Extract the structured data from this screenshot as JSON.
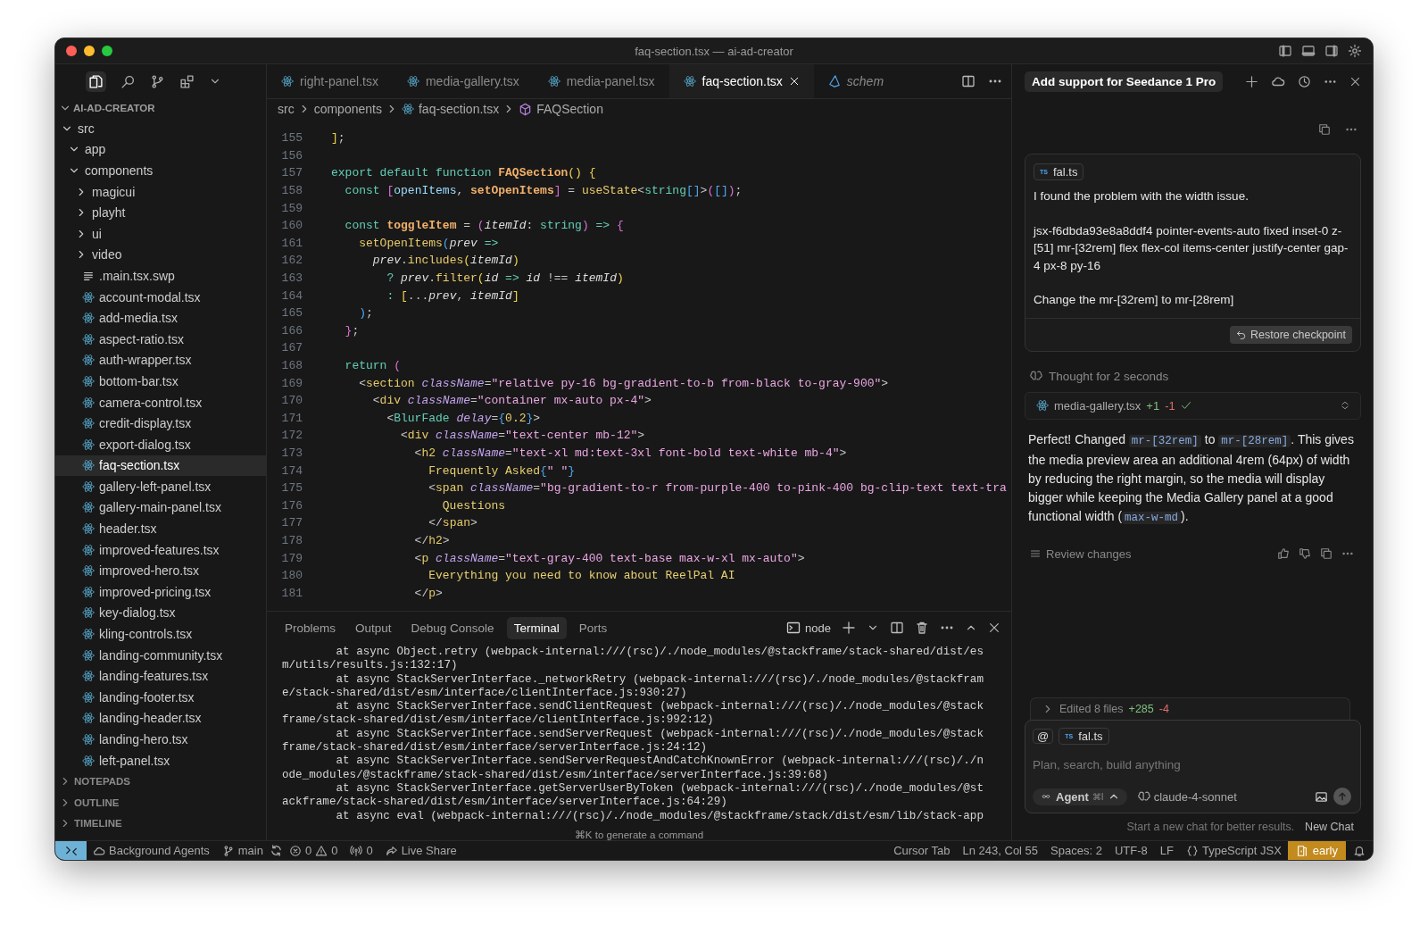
{
  "window": {
    "title": "faq-section.tsx — ai-ad-creator"
  },
  "explorer": {
    "title": "AI-AD-CREATOR",
    "tree": [
      {
        "name": "src",
        "kind": "folder",
        "expanded": true,
        "selected": false,
        "children": [
          {
            "name": "app",
            "kind": "folder",
            "expanded": true,
            "selected": false
          },
          {
            "name": "components",
            "kind": "folder",
            "expanded": true,
            "selected": false,
            "children": [
              {
                "name": "magicui",
                "kind": "folder",
                "expanded": false,
                "selected": false
              },
              {
                "name": "playht",
                "kind": "folder",
                "expanded": false,
                "selected": false
              },
              {
                "name": "ui",
                "kind": "folder",
                "expanded": false,
                "selected": false
              },
              {
                "name": "video",
                "kind": "folder",
                "expanded": false,
                "selected": false
              },
              {
                "name": ".main.tsx.swp",
                "kind": "text",
                "selected": false
              },
              {
                "name": "account-modal.tsx",
                "kind": "react",
                "selected": false
              },
              {
                "name": "add-media.tsx",
                "kind": "react",
                "selected": false
              },
              {
                "name": "aspect-ratio.tsx",
                "kind": "react",
                "selected": false
              },
              {
                "name": "auth-wrapper.tsx",
                "kind": "react",
                "selected": false
              },
              {
                "name": "bottom-bar.tsx",
                "kind": "react",
                "selected": false
              },
              {
                "name": "camera-control.tsx",
                "kind": "react",
                "selected": false
              },
              {
                "name": "credit-display.tsx",
                "kind": "react",
                "selected": false
              },
              {
                "name": "export-dialog.tsx",
                "kind": "react",
                "selected": false
              },
              {
                "name": "faq-section.tsx",
                "kind": "react",
                "selected": true
              },
              {
                "name": "gallery-left-panel.tsx",
                "kind": "react",
                "selected": false
              },
              {
                "name": "gallery-main-panel.tsx",
                "kind": "react",
                "selected": false
              },
              {
                "name": "header.tsx",
                "kind": "react",
                "selected": false
              },
              {
                "name": "improved-features.tsx",
                "kind": "react",
                "selected": false
              },
              {
                "name": "improved-hero.tsx",
                "kind": "react",
                "selected": false
              },
              {
                "name": "improved-pricing.tsx",
                "kind": "react",
                "selected": false
              },
              {
                "name": "key-dialog.tsx",
                "kind": "react",
                "selected": false
              },
              {
                "name": "kling-controls.tsx",
                "kind": "react",
                "selected": false
              },
              {
                "name": "landing-community.tsx",
                "kind": "react",
                "selected": false
              },
              {
                "name": "landing-features.tsx",
                "kind": "react",
                "selected": false
              },
              {
                "name": "landing-footer.tsx",
                "kind": "react",
                "selected": false
              },
              {
                "name": "landing-header.tsx",
                "kind": "react",
                "selected": false
              },
              {
                "name": "landing-hero.tsx",
                "kind": "react",
                "selected": false
              },
              {
                "name": "left-panel.tsx",
                "kind": "react",
                "selected": false
              }
            ]
          }
        ]
      }
    ],
    "sections": [
      {
        "title": "NOTEPADS",
        "expanded": false
      },
      {
        "title": "OUTLINE",
        "expanded": false
      },
      {
        "title": "TIMELINE",
        "expanded": false
      }
    ]
  },
  "editor": {
    "tabs": [
      {
        "label": "right-panel.tsx",
        "kind": "react",
        "selected": false,
        "preview": false
      },
      {
        "label": "media-gallery.tsx",
        "kind": "react",
        "selected": false,
        "preview": false
      },
      {
        "label": "media-panel.tsx",
        "kind": "react",
        "selected": false,
        "preview": false
      },
      {
        "label": "faq-section.tsx",
        "kind": "react",
        "selected": true,
        "preview": false
      },
      {
        "label": "schem",
        "kind": "prisma",
        "selected": false,
        "preview": true
      }
    ],
    "breadcrumbs": [
      {
        "label": "src",
        "kind": "folder"
      },
      {
        "label": "components",
        "kind": "folder"
      },
      {
        "label": "faq-section.tsx",
        "kind": "react"
      },
      {
        "label": "FAQSection",
        "kind": "symbol"
      }
    ],
    "lines": [
      {
        "num": "155",
        "tokens": [
          {
            "kind": "b1",
            "text": "]"
          },
          {
            "kind": "p",
            "text": ";"
          }
        ]
      },
      {
        "num": "156"
      },
      {
        "num": "157",
        "tokens": [
          {
            "kind": "kw",
            "text": "export default function "
          },
          {
            "kind": "fn",
            "text": "FAQSection"
          },
          {
            "kind": "b1",
            "text": "()"
          },
          {
            "kind": "b1",
            "text": " {"
          }
        ]
      },
      {
        "num": "158",
        "tokens": [
          {
            "kind": "kw",
            "text": "  const "
          },
          {
            "kind": "b2",
            "text": "["
          },
          {
            "kind": "var",
            "text": "openItems"
          },
          {
            "kind": "p",
            "text": ", "
          },
          {
            "kind": "fn",
            "text": "setOpenItems"
          },
          {
            "kind": "b2",
            "text": "]"
          },
          {
            "kind": "p",
            "text": " = "
          },
          {
            "kind": "method",
            "text": "useState"
          },
          {
            "kind": "p",
            "text": "<"
          },
          {
            "kind": "type",
            "text": "string"
          },
          {
            "kind": "b3",
            "text": "[]"
          },
          {
            "kind": "p",
            "text": ">"
          },
          {
            "kind": "b2",
            "text": "("
          },
          {
            "kind": "b3",
            "text": "[]"
          },
          {
            "kind": "b2",
            "text": ")"
          },
          {
            "kind": "p",
            "text": ";"
          }
        ]
      },
      {
        "num": "159"
      },
      {
        "num": "160",
        "tokens": [
          {
            "kind": "kw",
            "text": "  const "
          },
          {
            "kind": "fn",
            "text": "toggleItem"
          },
          {
            "kind": "p",
            "text": " = "
          },
          {
            "kind": "b2",
            "text": "("
          },
          {
            "kind": "param",
            "text": "itemId"
          },
          {
            "kind": "p",
            "text": ": "
          },
          {
            "kind": "type",
            "text": "string"
          },
          {
            "kind": "b2",
            "text": ")"
          },
          {
            "kind": "kw",
            "text": " => "
          },
          {
            "kind": "b2",
            "text": "{"
          }
        ]
      },
      {
        "num": "161",
        "tokens": [
          {
            "kind": "method",
            "text": "    setOpenItems"
          },
          {
            "kind": "b3",
            "text": "("
          },
          {
            "kind": "param",
            "text": "prev"
          },
          {
            "kind": "kw",
            "text": " =>"
          }
        ]
      },
      {
        "num": "162",
        "tokens": [
          {
            "kind": "param",
            "text": "      prev"
          },
          {
            "kind": "p",
            "text": "."
          },
          {
            "kind": "method",
            "text": "includes"
          },
          {
            "kind": "b1",
            "text": "("
          },
          {
            "kind": "param",
            "text": "itemId"
          },
          {
            "kind": "b1",
            "text": ")"
          }
        ]
      },
      {
        "num": "163",
        "tokens": [
          {
            "kind": "kw",
            "text": "        ? "
          },
          {
            "kind": "param",
            "text": "prev"
          },
          {
            "kind": "p",
            "text": "."
          },
          {
            "kind": "method",
            "text": "filter"
          },
          {
            "kind": "b1",
            "text": "("
          },
          {
            "kind": "param",
            "text": "id"
          },
          {
            "kind": "kw",
            "text": " => "
          },
          {
            "kind": "param",
            "text": "id"
          },
          {
            "kind": "p",
            "text": " !== "
          },
          {
            "kind": "param",
            "text": "itemId"
          },
          {
            "kind": "b1",
            "text": ")"
          }
        ]
      },
      {
        "num": "164",
        "tokens": [
          {
            "kind": "kw",
            "text": "        : "
          },
          {
            "kind": "b1",
            "text": "["
          },
          {
            "kind": "p",
            "text": "..."
          },
          {
            "kind": "param",
            "text": "prev"
          },
          {
            "kind": "p",
            "text": ", "
          },
          {
            "kind": "param",
            "text": "itemId"
          },
          {
            "kind": "b1",
            "text": "]"
          }
        ]
      },
      {
        "num": "165",
        "tokens": [
          {
            "kind": "b3",
            "text": "    )"
          },
          {
            "kind": "p",
            "text": ";"
          }
        ]
      },
      {
        "num": "166",
        "tokens": [
          {
            "kind": "b2",
            "text": "  }"
          },
          {
            "kind": "p",
            "text": ";"
          }
        ]
      },
      {
        "num": "167"
      },
      {
        "num": "168",
        "tokens": [
          {
            "kind": "kw",
            "text": "  return "
          },
          {
            "kind": "b2",
            "text": "("
          }
        ]
      },
      {
        "num": "169",
        "tokens": [
          {
            "kind": "p",
            "text": "    <"
          },
          {
            "kind": "tag",
            "text": "section"
          },
          {
            "kind": "attr",
            "text": " className"
          },
          {
            "kind": "p",
            "text": "="
          },
          {
            "kind": "str",
            "text": "\"relative py-16 bg-gradient-to-b from-black to-gray-900\""
          },
          {
            "kind": "p",
            "text": ">"
          }
        ]
      },
      {
        "num": "170",
        "tokens": [
          {
            "kind": "p",
            "text": "      <"
          },
          {
            "kind": "tag",
            "text": "div"
          },
          {
            "kind": "attr",
            "text": " className"
          },
          {
            "kind": "p",
            "text": "="
          },
          {
            "kind": "str",
            "text": "\"container mx-auto px-4\""
          },
          {
            "kind": "p",
            "text": ">"
          }
        ]
      },
      {
        "num": "171",
        "tokens": [
          {
            "kind": "p",
            "text": "        <"
          },
          {
            "kind": "comp",
            "text": "BlurFade"
          },
          {
            "kind": "attr",
            "text": " delay"
          },
          {
            "kind": "p",
            "text": "="
          },
          {
            "kind": "b3",
            "text": "{"
          },
          {
            "kind": "text",
            "text": "0.2"
          },
          {
            "kind": "b3",
            "text": "}"
          },
          {
            "kind": "p",
            "text": ">"
          }
        ]
      },
      {
        "num": "172",
        "tokens": [
          {
            "kind": "p",
            "text": "          <"
          },
          {
            "kind": "tag",
            "text": "div"
          },
          {
            "kind": "attr",
            "text": " className"
          },
          {
            "kind": "p",
            "text": "="
          },
          {
            "kind": "str",
            "text": "\"text-center mb-12\""
          },
          {
            "kind": "p",
            "text": ">"
          }
        ]
      },
      {
        "num": "173",
        "tokens": [
          {
            "kind": "p",
            "text": "            <"
          },
          {
            "kind": "tag",
            "text": "h2"
          },
          {
            "kind": "attr",
            "text": " className"
          },
          {
            "kind": "p",
            "text": "="
          },
          {
            "kind": "str",
            "text": "\"text-xl md:text-3xl font-bold text-white mb-4\""
          },
          {
            "kind": "p",
            "text": ">"
          }
        ]
      },
      {
        "num": "174",
        "tokens": [
          {
            "kind": "text",
            "text": "              Frequently Asked"
          },
          {
            "kind": "b3",
            "text": "{"
          },
          {
            "kind": "str",
            "text": "\" \""
          },
          {
            "kind": "b3",
            "text": "}"
          }
        ]
      },
      {
        "num": "175",
        "tokens": [
          {
            "kind": "p",
            "text": "              <"
          },
          {
            "kind": "tag",
            "text": "span"
          },
          {
            "kind": "attr",
            "text": " className"
          },
          {
            "kind": "p",
            "text": "="
          },
          {
            "kind": "str",
            "text": "\"bg-gradient-to-r from-purple-400 to-pink-400 bg-clip-text text-tra"
          }
        ]
      },
      {
        "num": "176",
        "tokens": [
          {
            "kind": "text",
            "text": "                Questions"
          }
        ]
      },
      {
        "num": "177",
        "tokens": [
          {
            "kind": "p",
            "text": "              </"
          },
          {
            "kind": "tag",
            "text": "span"
          },
          {
            "kind": "p",
            "text": ">"
          }
        ]
      },
      {
        "num": "178",
        "tokens": [
          {
            "kind": "p",
            "text": "            </"
          },
          {
            "kind": "tag",
            "text": "h2"
          },
          {
            "kind": "p",
            "text": ">"
          }
        ]
      },
      {
        "num": "179",
        "tokens": [
          {
            "kind": "p",
            "text": "            <"
          },
          {
            "kind": "tag",
            "text": "p"
          },
          {
            "kind": "attr",
            "text": " className"
          },
          {
            "kind": "p",
            "text": "="
          },
          {
            "kind": "str",
            "text": "\"text-gray-400 text-base max-w-xl mx-auto\""
          },
          {
            "kind": "p",
            "text": ">"
          }
        ]
      },
      {
        "num": "180",
        "tokens": [
          {
            "kind": "text",
            "text": "              Everything you need to know about ReelPal AI"
          }
        ]
      },
      {
        "num": "181",
        "tokens": [
          {
            "kind": "p",
            "text": "            </"
          },
          {
            "kind": "tag",
            "text": "p"
          },
          {
            "kind": "p",
            "text": ">"
          }
        ]
      }
    ]
  },
  "panel": {
    "tabs": [
      {
        "label": "Problems",
        "selected": false
      },
      {
        "label": "Output",
        "selected": false
      },
      {
        "label": "Debug Console",
        "selected": false
      },
      {
        "label": "Terminal",
        "selected": true
      },
      {
        "label": "Ports",
        "selected": false
      }
    ],
    "shell": "node",
    "lines": [
      "        at async Object.retry (webpack-internal:///(rsc)/./node_modules/@stackframe/stack-shared/dist/es",
      "m/utils/results.js:132:17)",
      "        at async StackServerInterface._networkRetry (webpack-internal:///(rsc)/./node_modules/@stackfram",
      "e/stack-shared/dist/esm/interface/clientInterface.js:930:27)",
      "        at async StackServerInterface.sendClientRequest (webpack-internal:///(rsc)/./node_modules/@stack",
      "frame/stack-shared/dist/esm/interface/clientInterface.js:992:12)",
      "        at async StackServerInterface.sendServerRequest (webpack-internal:///(rsc)/./node_modules/@stack",
      "frame/stack-shared/dist/esm/interface/serverInterface.js:24:12)",
      "        at async StackServerInterface.sendServerRequestAndCatchKnownError (webpack-internal:///(rsc)/./n",
      "ode_modules/@stackframe/stack-shared/dist/esm/interface/serverInterface.js:39:68)",
      "        at async StackServerInterface.getServerUserByToken (webpack-internal:///(rsc)/./node_modules/@st",
      "ackframe/stack-shared/dist/esm/interface/serverInterface.js:64:29)",
      "        at async eval (webpack-internal:///(rsc)/./node_modules/@stackframe/stack/dist/esm/lib/stack-app"
    ],
    "hint": "⌘K to generate a command"
  },
  "chat": {
    "title": "Add support for Seedance 1 Pro",
    "message": {
      "file": {
        "badge": "TS",
        "name": "fal.ts"
      },
      "paragraphs": [
        "I found the problem with the width issue.",
        "jsx-f6dbda93e8a8ddf4 pointer-events-auto fixed inset-0 z-[51] mr-[32rem] flex flex-col items-center justify-center gap-4 px-8 py-16",
        "Change the mr-[32rem] to mr-[28rem]"
      ],
      "button": "Restore checkpoint"
    },
    "thought": "Thought for 2 seconds",
    "edit": {
      "file": "media-gallery.tsx",
      "added": "+1",
      "removed": "-1"
    },
    "reply": [
      {
        "kind": "text",
        "text": "Perfect! Changed "
      },
      {
        "kind": "code",
        "text": "mr-[32rem]"
      },
      {
        "kind": "text",
        "text": " to "
      },
      {
        "kind": "code",
        "text": "mr-[28rem]"
      },
      {
        "kind": "text",
        "text": ". This gives the media preview area an additional 4rem (64px) of width by reducing the right margin, so the media will display bigger while keeping the Media Gallery panel at a good functional width ("
      },
      {
        "kind": "code",
        "text": "max-w-md"
      },
      {
        "kind": "text",
        "text": ")."
      }
    ],
    "review": "Review changes",
    "summary": {
      "label": "Edited 8 files",
      "added": "+285",
      "removed": "-4"
    },
    "composer": {
      "mention": "@",
      "file": {
        "badge": "TS",
        "name": "fal.ts"
      },
      "placeholder": "Plan, search, build anything",
      "mode": "Agent",
      "shortcut": "⌘I",
      "model": "claude-4-sonnet"
    },
    "footer": {
      "hint": "Start a new chat for better results.",
      "link": "New Chat"
    }
  },
  "status_bar": {
    "left": [
      {
        "kind": "cloud",
        "text": "Background Agents"
      },
      {
        "kind": "branch",
        "text": "main"
      },
      {
        "kind": "sync"
      },
      {
        "kind": "problems",
        "errors": "0",
        "warnings": "0"
      },
      {
        "kind": "ports",
        "text": "0"
      },
      {
        "kind": "share",
        "text": "Live Share"
      }
    ],
    "right": [
      {
        "kind": "plain",
        "text": "Cursor Tab"
      },
      {
        "kind": "plain",
        "text": "Ln 243, Col 55"
      },
      {
        "kind": "plain",
        "text": "Spaces: 2"
      },
      {
        "kind": "plain",
        "text": "UTF-8"
      },
      {
        "kind": "plain",
        "text": "LF"
      },
      {
        "kind": "language",
        "text": "TypeScript JSX"
      },
      {
        "kind": "badge",
        "text": "early"
      },
      {
        "kind": "bell"
      }
    ]
  }
}
